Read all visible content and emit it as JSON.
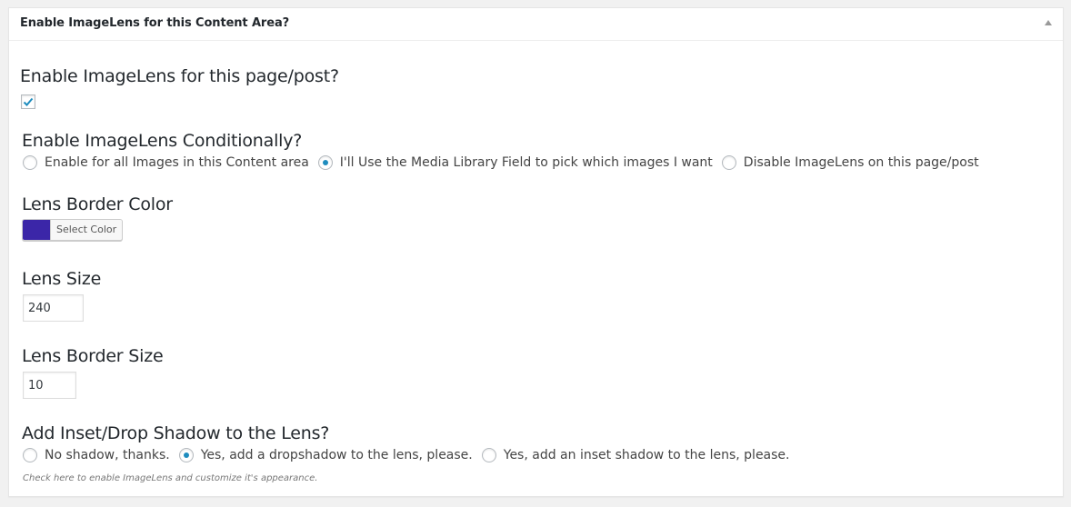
{
  "metabox": {
    "title": "Enable ImageLens for this Content Area?"
  },
  "enable": {
    "label": "Enable ImageLens for this page/post?",
    "checked": true
  },
  "conditional": {
    "label": "Enable ImageLens Conditionally?",
    "options": [
      {
        "label": "Enable for all Images in this Content area",
        "selected": false
      },
      {
        "label": "I'll Use the Media Library Field to pick which images I want",
        "selected": true
      },
      {
        "label": "Disable ImageLens on this page/post",
        "selected": false
      }
    ]
  },
  "border_color": {
    "label": "Lens Border Color",
    "button_label": "Select Color",
    "value": "#3b26a8"
  },
  "lens_size": {
    "label": "Lens Size",
    "value": "240"
  },
  "border_size": {
    "label": "Lens Border Size",
    "value": "10"
  },
  "shadow": {
    "label": "Add Inset/Drop Shadow to the Lens?",
    "options": [
      {
        "label": "No shadow, thanks.",
        "selected": false
      },
      {
        "label": "Yes, add a dropshadow to the lens, please.",
        "selected": true
      },
      {
        "label": "Yes, add an inset shadow to the lens, please.",
        "selected": false
      }
    ]
  },
  "help": "Check here to enable ImageLens and customize it's appearance.",
  "colors": {
    "accent": "#1e8cbe"
  }
}
